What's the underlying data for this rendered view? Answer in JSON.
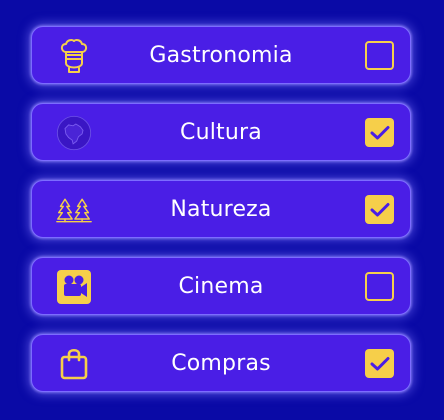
{
  "colors": {
    "background": "#0a0aa6",
    "card": "#4a1ee6",
    "accent": "#f6cf4a",
    "text": "#ffffff"
  },
  "items": [
    {
      "label": "Gastronomia",
      "icon": "chef-icon",
      "checked": false
    },
    {
      "label": "Cultura",
      "icon": "brazil-map-icon",
      "checked": true
    },
    {
      "label": "Natureza",
      "icon": "trees-icon",
      "checked": true
    },
    {
      "label": "Cinema",
      "icon": "movie-camera-icon",
      "checked": false
    },
    {
      "label": "Compras",
      "icon": "shopping-bag-icon",
      "checked": true
    }
  ]
}
